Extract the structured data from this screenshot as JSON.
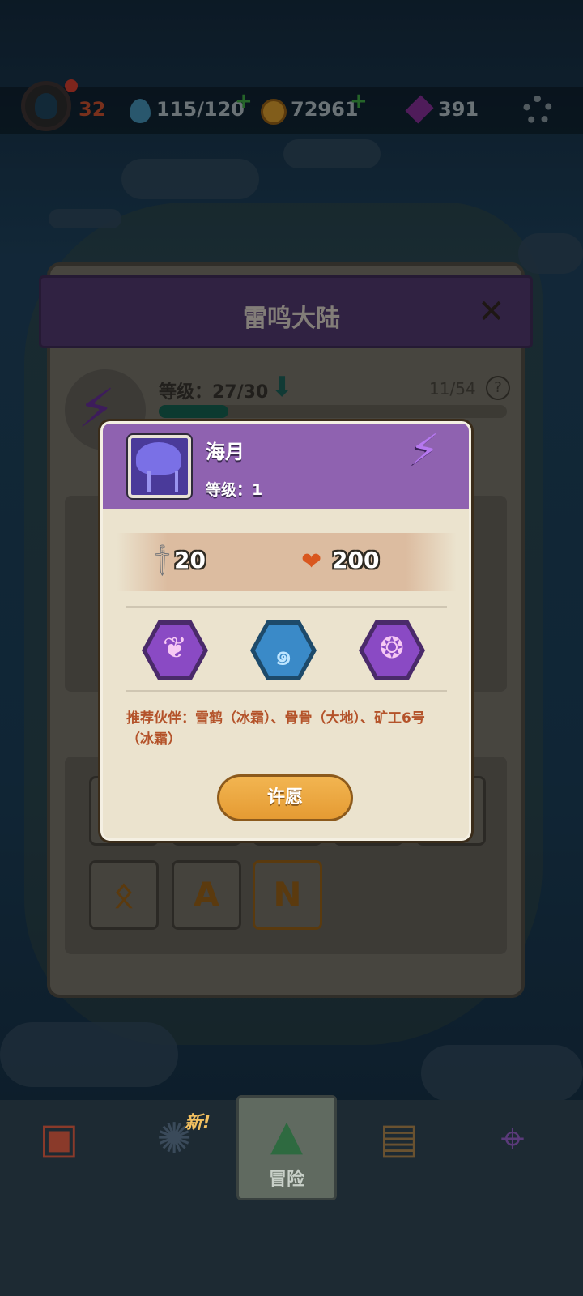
{
  "status_bar": {
    "level": "32",
    "energy": "115/120",
    "coins": "72961",
    "gems": "391"
  },
  "region_panel": {
    "title": "雷鸣大陆",
    "level_label": "等级：27/30",
    "progress_count": "11/54",
    "progress_fraction": 0.2,
    "help_label": "?"
  },
  "runes": [
    "ᛟ",
    "A",
    "N"
  ],
  "hero_card": {
    "name": "海月",
    "level": "等级：1",
    "attack": "20",
    "hp": "200",
    "skills": [
      "purple-droplets-skill-icon",
      "blue-vortex-skill-icon",
      "purple-orbs-skill-icon"
    ],
    "partners_text": "推荐伙伴：雪鹤（冰霜）、骨骨（大地）、矿工6号（冰霜）",
    "wish_button": "许愿",
    "element_color": "#8f62b0"
  },
  "bottom_nav": {
    "new_badge": "新!",
    "active_label": "冒险",
    "items": [
      "shop-icon",
      "portal-icon",
      "adventure-icon",
      "chest-icon",
      "map-pin-icon"
    ]
  }
}
